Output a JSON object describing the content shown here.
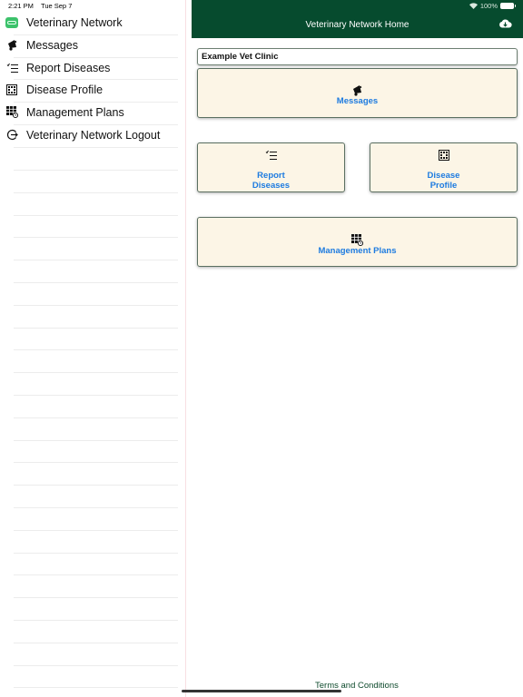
{
  "status_bar": {
    "time": "2:21 PM",
    "date": "Tue Sep 7",
    "battery": "100%"
  },
  "sidebar": {
    "items": [
      {
        "label": "Veterinary Network",
        "icon": "app-logo-icon"
      },
      {
        "label": "Messages",
        "icon": "megaphone-icon"
      },
      {
        "label": "Report Diseases",
        "icon": "checklist-icon"
      },
      {
        "label": "Disease Profile",
        "icon": "grid-dots-icon"
      },
      {
        "label": "Management Plans",
        "icon": "table-clock-icon"
      },
      {
        "label": "Veterinary Network Logout",
        "icon": "logout-icon"
      }
    ]
  },
  "header": {
    "title": "Veterinary Network Home",
    "action_icon": "cloud-download-icon"
  },
  "main": {
    "clinic_name": "Example Vet Clinic",
    "tiles": [
      {
        "label": "Messages",
        "icon": "megaphone-icon"
      },
      {
        "label": "Report\nDiseases",
        "line1": "Report",
        "line2": "Diseases",
        "icon": "checklist-icon"
      },
      {
        "label": "Disease\nProfile",
        "line1": "Disease",
        "line2": "Profile",
        "icon": "grid-dots-icon"
      },
      {
        "label": "Management Plans",
        "icon": "table-clock-icon"
      }
    ],
    "footer_link": "Terms and Conditions"
  },
  "colors": {
    "header_bg": "#064b2e",
    "tile_bg": "#fcf5e6",
    "tile_label": "#1d7be0",
    "app_logo": "#3cc26b"
  }
}
